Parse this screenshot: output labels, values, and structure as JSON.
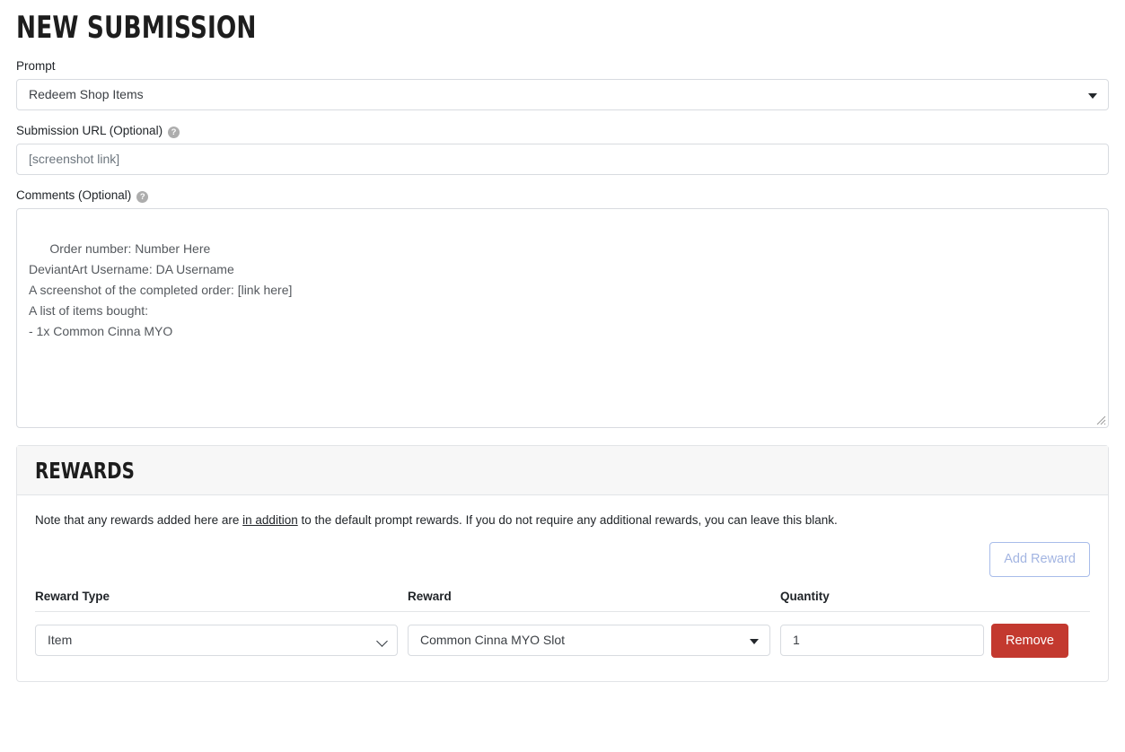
{
  "page": {
    "title": "NEW SUBMISSION"
  },
  "form": {
    "prompt": {
      "label": "Prompt",
      "value": "Redeem Shop Items"
    },
    "submission_url": {
      "label": "Submission URL (Optional)",
      "help_glyph": "?",
      "placeholder": "[screenshot link]",
      "value": "[screenshot link]"
    },
    "comments": {
      "label": "Comments (Optional)",
      "help_glyph": "?",
      "value": "Order number: Number Here\nDeviantArt Username: DA Username\nA screenshot of the completed order: [link here]\nA list of items bought:\n- 1x Common Cinna MYO"
    }
  },
  "rewards": {
    "heading": "REWARDS",
    "note_prefix": "Note that any rewards added here are ",
    "note_emphasis": "in addition",
    "note_suffix": " to the default prompt rewards. If you do not require any additional rewards, you can leave this blank.",
    "add_button": "Add Reward",
    "columns": {
      "type": "Reward Type",
      "reward": "Reward",
      "quantity": "Quantity"
    },
    "rows": [
      {
        "type": "Item",
        "reward": "Common Cinna MYO Slot",
        "quantity": "1",
        "remove_label": "Remove"
      }
    ]
  },
  "colors": {
    "remove_button": "#c3392f",
    "add_reward_outline": "#a8bcea",
    "card_header_bg": "#f7f7f7",
    "border": "#d8dbe0"
  }
}
